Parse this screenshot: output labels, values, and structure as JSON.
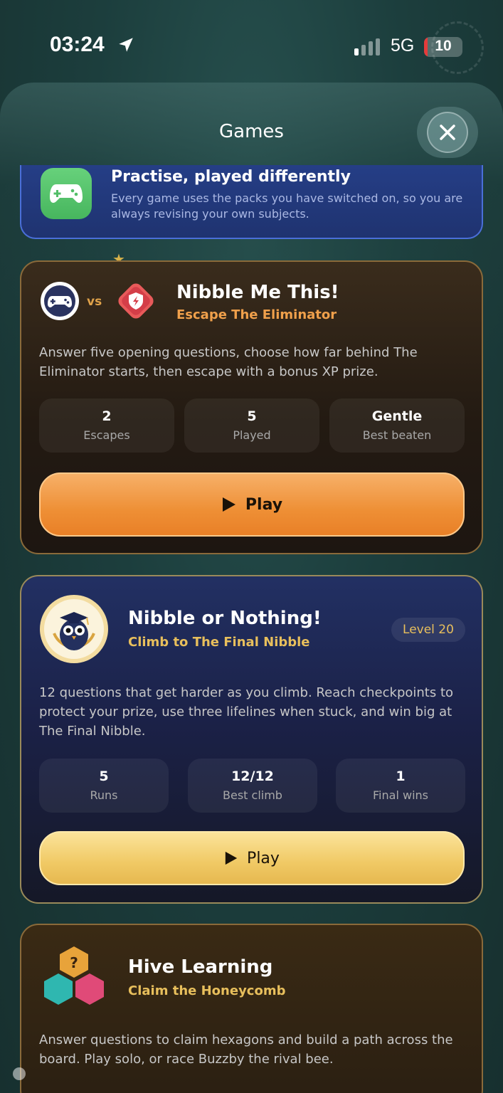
{
  "status_bar": {
    "time": "03:24",
    "network": "5G",
    "battery": "10",
    "battery_level": 0.1,
    "battery_color": "#e53b3b"
  },
  "header": {
    "title": "Games",
    "close_icon": "close-icon"
  },
  "intro": {
    "icon": "gamepad-icon",
    "heading": "Practise, played differently",
    "body": "Every game uses the packs you have switched on, so you are always revising your own subjects."
  },
  "games": [
    {
      "title": "Nibble Me This!",
      "subtitle": "Escape The Eliminator",
      "subtitle_color": "#f0a04b",
      "vs_label": "vs",
      "description": "Answer five opening questions, choose how far behind The Eliminator starts, then escape with a bonus XP prize.",
      "stats": [
        {
          "value": "2",
          "label": "Escapes"
        },
        {
          "value": "5",
          "label": "Played"
        },
        {
          "value": "Gentle",
          "label": "Best beaten"
        }
      ],
      "play_label": "Play",
      "accent": "#ee8f35"
    },
    {
      "title": "Nibble or Nothing!",
      "subtitle": "Climb to The Final Nibble",
      "subtitle_color": "#e8bf5c",
      "badge": "Level 20",
      "description": "12 questions that get harder as you climb. Reach checkpoints to protect your prize, use three lifelines when stuck, and win big at The Final Nibble.",
      "stats": [
        {
          "value": "5",
          "label": "Runs"
        },
        {
          "value": "12/12",
          "label": "Best climb"
        },
        {
          "value": "1",
          "label": "Final wins"
        }
      ],
      "play_label": "Play",
      "accent": "#f0c964"
    },
    {
      "title": "Hive Learning",
      "subtitle": "Claim the Honeycomb",
      "subtitle_color": "#e8bf5c",
      "hex_label": "?",
      "description": "Answer questions to claim hexagons and build a path across the board. Play solo, or race Buzzby the rival bee."
    }
  ]
}
